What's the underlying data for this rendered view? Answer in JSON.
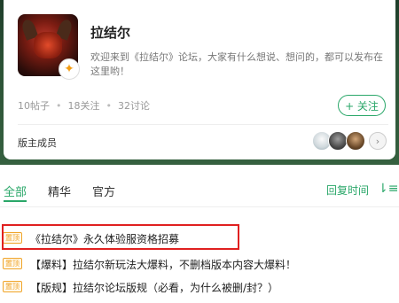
{
  "forum": {
    "name": "拉结尔",
    "description": "欢迎来到《拉结尔》论坛，大家有什么想说、想问的，都可以发布在这里哟！",
    "stats": {
      "posts": "10帖子",
      "follows": "18关注",
      "discussions": "32讨论"
    },
    "follow_label": "+ 关注",
    "badge_icon": "tencent-games-icon"
  },
  "moderators": {
    "label": "版主成员",
    "avatars": [
      "moderator-avatar-1",
      "moderator-avatar-2",
      "moderator-avatar-3"
    ]
  },
  "tabs": {
    "items": [
      {
        "label": "全部",
        "active": true
      },
      {
        "label": "精华",
        "active": false
      },
      {
        "label": "官方",
        "active": false
      }
    ],
    "sort_label": "回复时间"
  },
  "posts": [
    {
      "tag": "置顶",
      "title": "《拉结尔》永久体验服资格招募",
      "highlighted": true
    },
    {
      "tag": "置顶",
      "title": "【爆料】拉结尔新玩法大爆料，不删档版本内容大爆料！",
      "highlighted": false
    },
    {
      "tag": "置顶",
      "title": "【版规】拉结尔论坛版规（必看，为什么被删/封？）",
      "highlighted": false
    }
  ],
  "colors": {
    "accent": "#2aa769",
    "pin": "#f0a52b",
    "highlight": "#e02020"
  }
}
